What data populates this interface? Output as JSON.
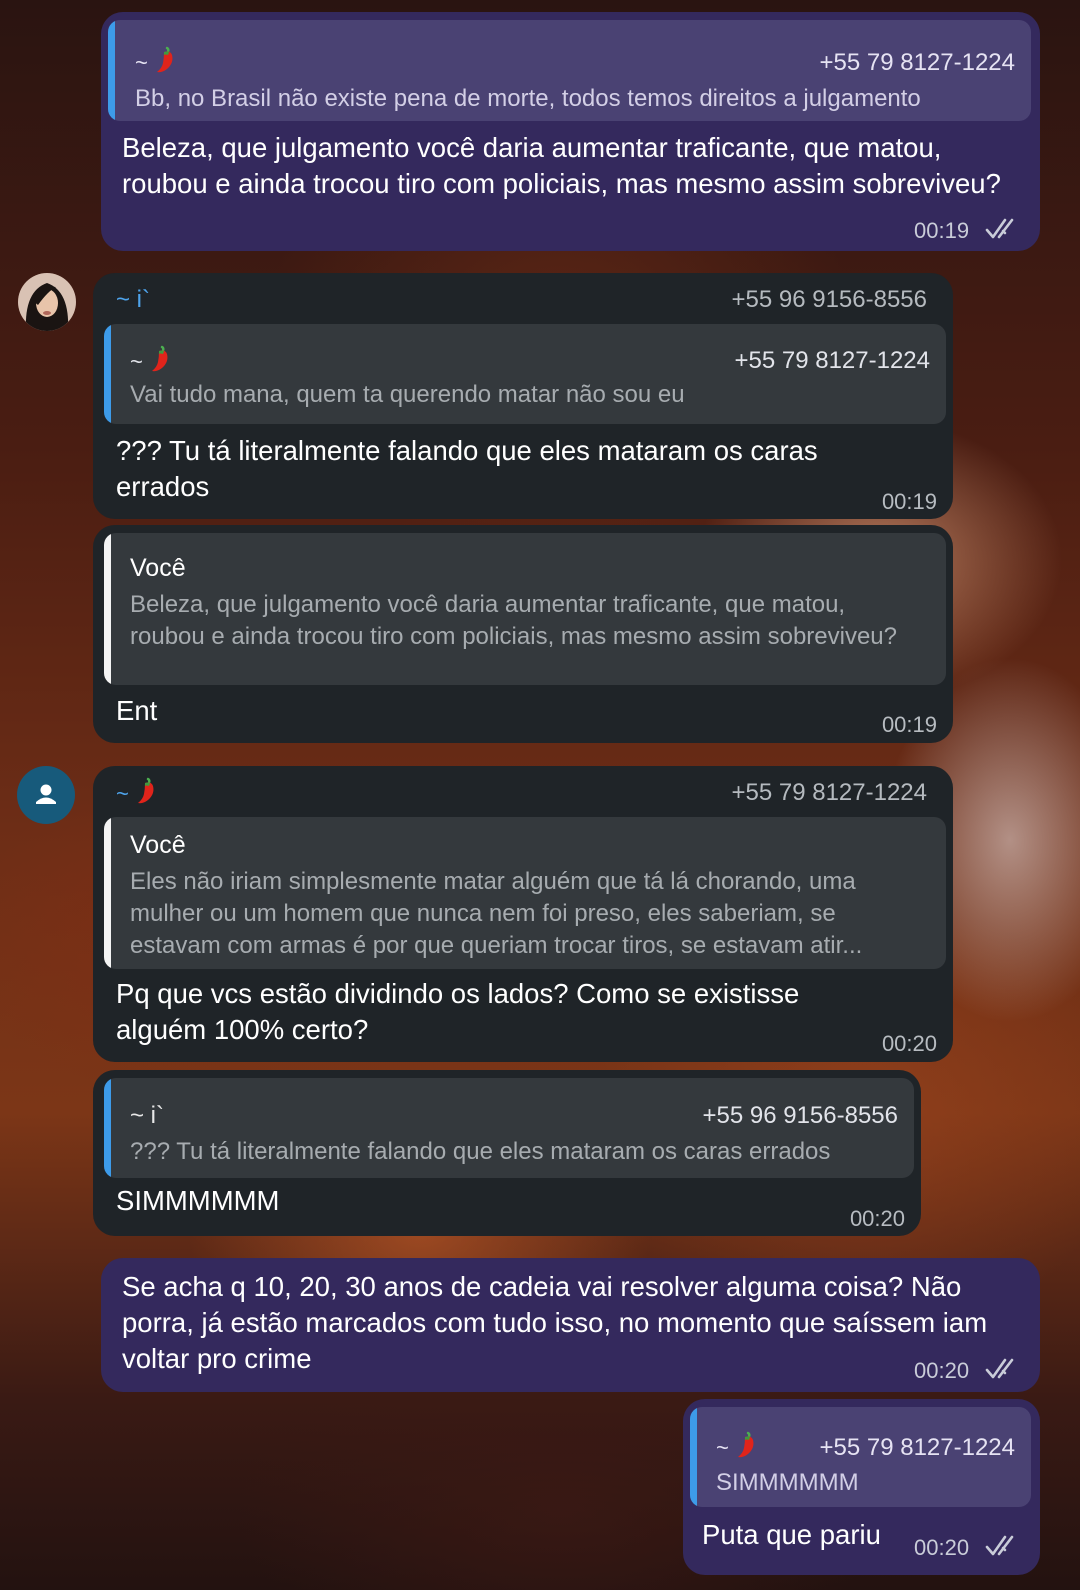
{
  "messages": [
    {
      "reply": {
        "name_prefix": "~",
        "name_emoji": "chili-pepper",
        "phone": "+55 79 8127-1224",
        "quote": "Bb, no Brasil não existe pena de morte, todos temos direitos a julgamento"
      },
      "text": "Beleza, que julgamento você daria aumentar traficante, que matou, roubou e ainda trocou tiro com policiais, mas mesmo assim sobreviveu?",
      "time": "00:19"
    },
    {
      "sender": {
        "name": "~ i`",
        "phone": "+55 96 9156-8556"
      },
      "reply": {
        "name_prefix": "~",
        "name_emoji": "chili-pepper",
        "phone": "+55 79 8127-1224",
        "quote": "Vai tudo mana, quem ta querendo matar não sou eu"
      },
      "text": "??? Tu tá literalmente falando que eles mataram os caras errados",
      "time": "00:19"
    },
    {
      "reply": {
        "name": "Você",
        "quote": "Beleza, que julgamento você daria aumentar traficante, que matou, roubou e ainda trocou tiro com policiais, mas mesmo assim sobreviveu?"
      },
      "text": "Ent",
      "time": "00:19"
    },
    {
      "sender": {
        "name_prefix": "~",
        "name_emoji": "chili-pepper",
        "phone": "+55 79 8127-1224"
      },
      "reply": {
        "name": "Você",
        "quote": "Eles não iriam simplesmente matar alguém que tá lá chorando, uma mulher ou um homem que nunca nem foi preso, eles saberiam, se estavam com armas é por que queriam trocar tiros, se estavam atir..."
      },
      "text": "Pq que vcs estão dividindo os lados? Como se existisse alguém 100% certo?",
      "time": "00:20"
    },
    {
      "reply": {
        "name": "~ i`",
        "phone": "+55 96 9156-8556",
        "quote": "??? Tu tá literalmente falando que eles mataram os caras errados"
      },
      "text": "SIMMMMMM",
      "time": "00:20"
    },
    {
      "text": "Se acha q 10, 20, 30  anos de cadeia vai resolver alguma coisa? Não porra, já estão marcados com tudo isso, no momento que saíssem iam voltar pro crime",
      "time": "00:20"
    },
    {
      "reply": {
        "name_prefix": "~",
        "name_emoji": "chili-pepper",
        "phone": "+55 79 8127-1224",
        "quote": "SIMMMMMM"
      },
      "text": "Puta que pariu",
      "time": "00:20"
    }
  ],
  "icons": {
    "read_receipt": "double-check-icon",
    "default_avatar": "person-icon",
    "emoji": "chili-pepper"
  },
  "colors": {
    "outgoing_bubble": "#34295d",
    "incoming_bubble": "#1f2428",
    "accent_blue": "#3d9be9",
    "timestamp": "#c9ccd8"
  }
}
